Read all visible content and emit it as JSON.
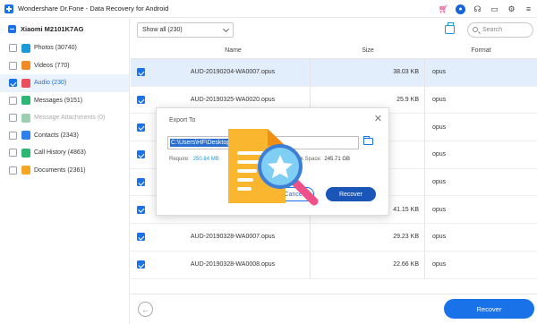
{
  "app": {
    "title": "Wondershare Dr.Fone - Data Recovery for Android",
    "accent": "#1a72e8"
  },
  "titlebar_icons": [
    "cart-icon",
    "account-icon",
    "headset-icon",
    "bookmark-icon",
    "gear-icon",
    "menu-icon"
  ],
  "sidebar": {
    "device": "Xiaomi M2101K7AG",
    "items": [
      {
        "label": "Photos (30740)",
        "checked": false,
        "icon": "photo-icon",
        "color": "#1a9bd8"
      },
      {
        "label": "Videos (770)",
        "checked": false,
        "icon": "video-icon",
        "color": "#f08a24"
      },
      {
        "label": "Audio (230)",
        "checked": true,
        "icon": "audio-icon",
        "color": "#e94f5f"
      },
      {
        "label": "Messages (9151)",
        "checked": false,
        "icon": "message-icon",
        "color": "#2bb673"
      },
      {
        "label": "Message Attachments (0)",
        "checked": false,
        "icon": "attachment-icon",
        "color": "#9ccfb0"
      },
      {
        "label": "Contacts (2343)",
        "checked": false,
        "icon": "contact-icon",
        "color": "#2f80ed"
      },
      {
        "label": "Call History (4863)",
        "checked": false,
        "icon": "call-icon",
        "color": "#2bb673"
      },
      {
        "label": "Documents (2361)",
        "checked": false,
        "icon": "document-icon",
        "color": "#f5a623"
      }
    ]
  },
  "toolbar": {
    "filter_value": "Show all (230)",
    "search_placeholder": "Search"
  },
  "table": {
    "columns": [
      "Name",
      "Size",
      "Format"
    ],
    "rows": [
      {
        "name": "AUD-20190204-WA0007.opus",
        "size": "38.03 KB",
        "format": "opus"
      },
      {
        "name": "AUD-20190325-WA0020.opus",
        "size": "25.9 KB",
        "format": "opus"
      },
      {
        "name": "",
        "size": "",
        "format": "opus"
      },
      {
        "name": "",
        "size": "",
        "format": "opus"
      },
      {
        "name": "",
        "size": "",
        "format": "opus"
      },
      {
        "name": "AUD-20190326-WA0051.opus",
        "size": "41.15 KB",
        "format": "opus"
      },
      {
        "name": "AUD-20190328-WA0007.opus",
        "size": "29.23 KB",
        "format": "opus"
      },
      {
        "name": "AUD-20190328-WA0008.opus",
        "size": "22.66 KB",
        "format": "opus"
      }
    ]
  },
  "footer": {
    "recover_label": "Recover"
  },
  "dialog": {
    "title": "Export To",
    "path": "C:\\Users\\HF\\Desktop",
    "require_label": "Require:",
    "require_value": "250.84 MB",
    "free_label": "ee Disk Space:",
    "free_value": "245.71 GB",
    "cancel_label": "Cancel",
    "recover_label": "Recover"
  }
}
